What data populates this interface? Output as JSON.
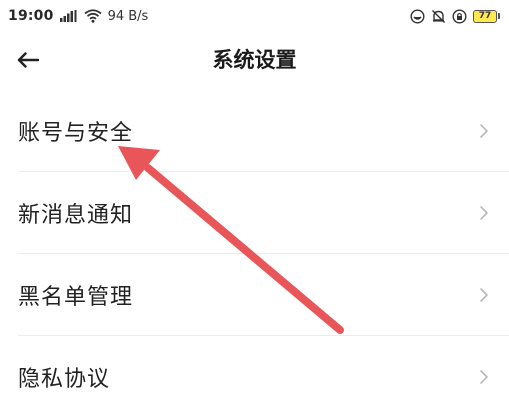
{
  "status_bar": {
    "time": "19:00",
    "network_speed": "94 B/s",
    "battery_level": "77",
    "icons": [
      "signal-icon",
      "wifi-icon",
      "face-icon",
      "alarm-off-icon",
      "lock-rotation-icon",
      "battery-icon"
    ]
  },
  "header": {
    "title": "系统设置",
    "back_icon": "arrow-left-icon"
  },
  "settings": {
    "items": [
      {
        "label": "账号与安全"
      },
      {
        "label": "新消息通知"
      },
      {
        "label": "黑名单管理"
      },
      {
        "label": "隐私协议"
      }
    ]
  },
  "colors": {
    "annotation_arrow": "#e8565a",
    "divider": "#ececec",
    "chevron": "#b9b9b9",
    "battery_fill": "#ffe94d"
  }
}
